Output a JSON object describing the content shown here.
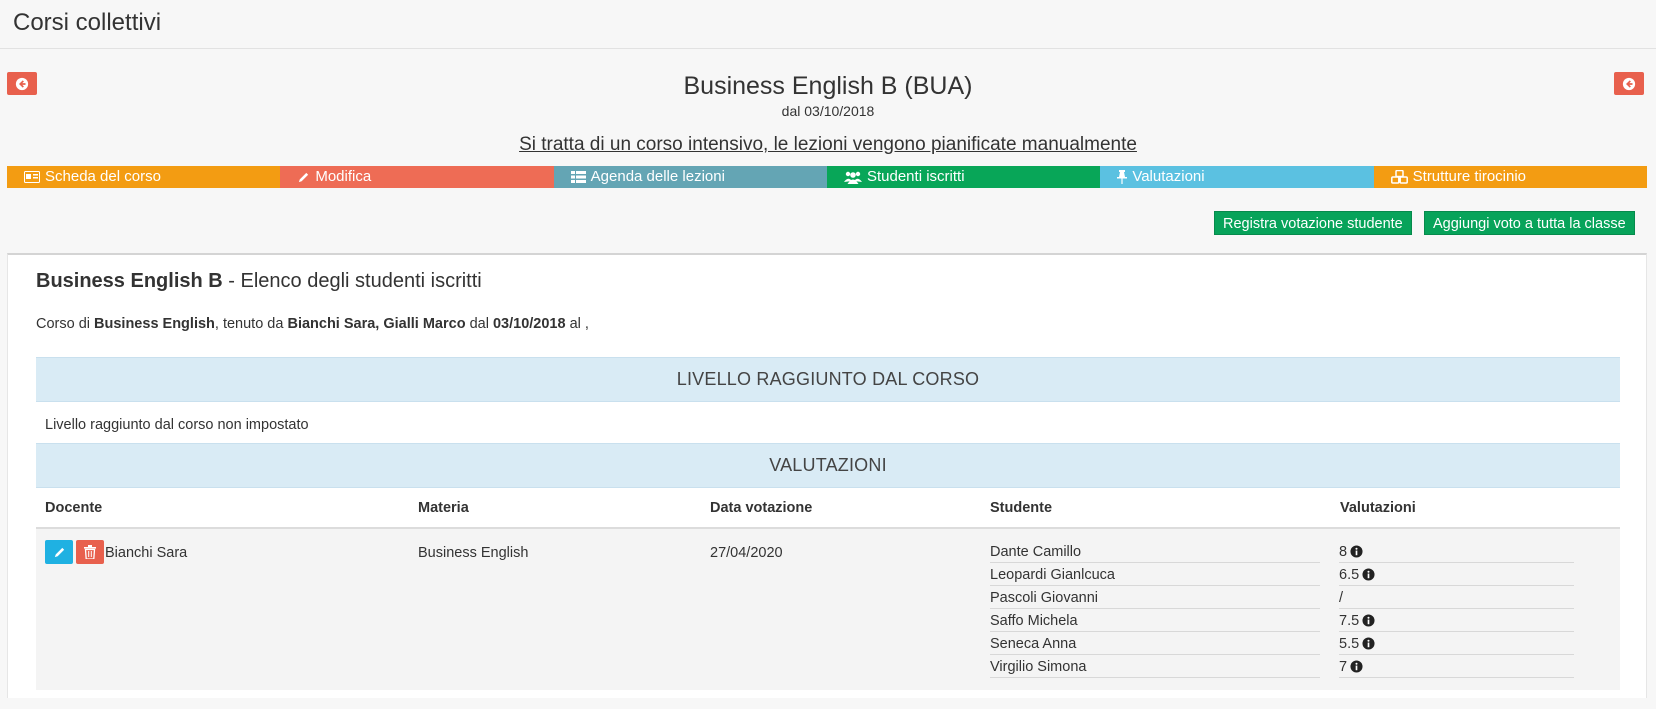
{
  "app": {
    "title": "Corsi collettivi"
  },
  "course": {
    "title": "Business English B (BUA)",
    "since": "dal 03/10/2018",
    "note": "Si tratta di un corso intensivo, le lezioni vengono pianificate manualmente"
  },
  "nav": {
    "items": [
      {
        "label": "Scheda del corso",
        "icon": "id-card-icon",
        "color": "#f39c12"
      },
      {
        "label": "Modifica",
        "icon": "pencil-icon",
        "color": "#ee6c55"
      },
      {
        "label": "Agenda delle lezioni",
        "icon": "table-list-icon",
        "color": "#64a5b4"
      },
      {
        "label": "Studenti iscritti",
        "icon": "users-icon",
        "color": "#08a658"
      },
      {
        "label": "Valutazioni",
        "icon": "pin-icon",
        "color": "#5bc1e1"
      },
      {
        "label": "Strutture tirocinio",
        "icon": "cubes-icon",
        "color": "#f39c12"
      }
    ]
  },
  "actions": {
    "register_vote": "Registra votazione studente",
    "add_class_vote": "Aggiungi voto a tutta la classe"
  },
  "panel": {
    "title_bold": "Business English B",
    "title_rest": " - Elenco degli studenti iscritti",
    "desc": {
      "p1": "Corso di ",
      "subject": "Business English",
      "p2": ", tenuto da ",
      "teachers": "Bianchi Sara, Gialli Marco",
      "p3": " dal ",
      "start": "03/10/2018",
      "p4": " al ,"
    },
    "level_header": "LIVELLO RAGGIUNTO DAL CORSO",
    "level_text": "Livello raggiunto dal corso non impostato",
    "ratings_header": "VALUTAZIONI",
    "columns": {
      "teacher": "Docente",
      "subject": "Materia",
      "date": "Data votazione",
      "student": "Studente",
      "ratings": "Valutazioni"
    },
    "row": {
      "teacher": "Bianchi Sara",
      "subject": "Business English",
      "date": "27/04/2020",
      "students": [
        {
          "name": "Dante Camillo",
          "grade": "8",
          "info": true
        },
        {
          "name": "Leopardi Gianlcuca",
          "grade": "6.5",
          "info": true
        },
        {
          "name": "Pascoli Giovanni",
          "grade": "/",
          "info": false
        },
        {
          "name": "Saffo Michela",
          "grade": "7.5",
          "info": true
        },
        {
          "name": "Seneca Anna",
          "grade": "5.5",
          "info": true
        },
        {
          "name": "Virgilio Simona",
          "grade": "7",
          "info": true
        }
      ]
    }
  },
  "colors": {
    "back_button": "#e8604d",
    "action_button": "#07a35a",
    "section_header": "#d9ebf5",
    "edit_button": "#1fb1e2",
    "delete_button": "#e8604d"
  }
}
